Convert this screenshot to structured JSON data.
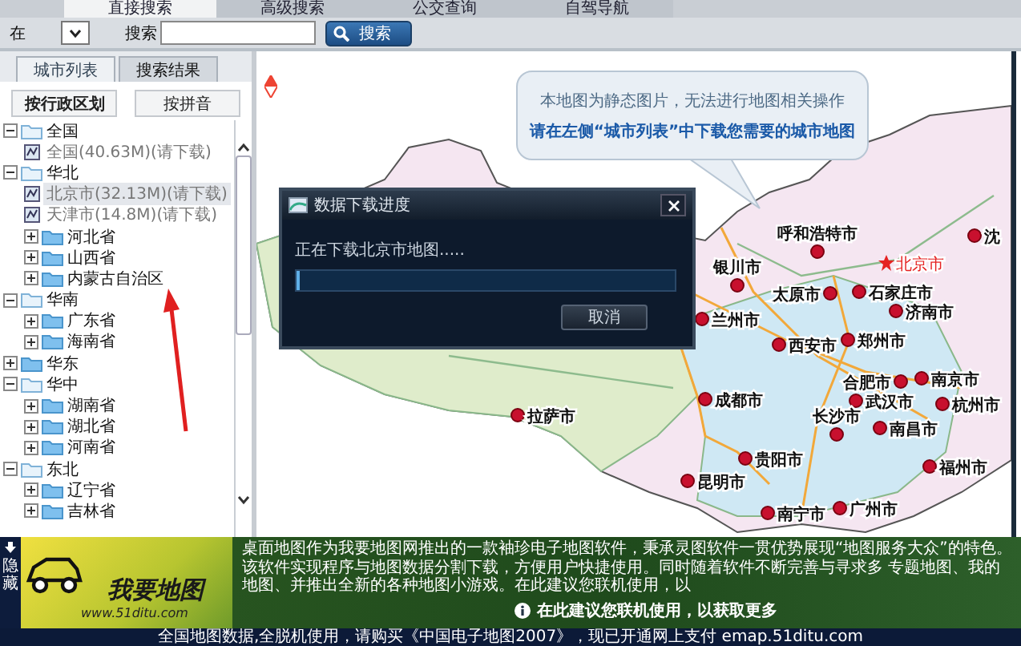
{
  "top_tabs": [
    {
      "label": "直接搜索",
      "selected": true
    },
    {
      "label": "高级搜索",
      "selected": false
    },
    {
      "label": "公交查询",
      "selected": false
    },
    {
      "label": "自驾导航",
      "selected": false
    }
  ],
  "search": {
    "scope_label": "在",
    "keyword_label": "搜索",
    "button": "搜索"
  },
  "left_panel": {
    "tabs": [
      {
        "label": "城市列表",
        "selected": true
      },
      {
        "label": "搜索结果",
        "selected": false
      }
    ],
    "sort_buttons": [
      {
        "label": "按行政区划",
        "selected": true
      },
      {
        "label": "按拼音",
        "selected": false
      }
    ],
    "tree": [
      {
        "kind": "folder",
        "label": "全国",
        "expanded": true,
        "children": [
          {
            "kind": "file",
            "label": "全国(40.63M)(请下载)",
            "selected": false
          }
        ]
      },
      {
        "kind": "folder",
        "label": "华北",
        "expanded": true,
        "children": [
          {
            "kind": "file",
            "label": "北京市(32.13M)(请下载)",
            "selected": true
          },
          {
            "kind": "file",
            "label": "天津市(14.8M)(请下载)",
            "selected": false
          },
          {
            "kind": "folder",
            "label": "河北省",
            "expanded": false
          },
          {
            "kind": "folder",
            "label": "山西省",
            "expanded": false
          },
          {
            "kind": "folder",
            "label": "内蒙古自治区",
            "expanded": false
          }
        ]
      },
      {
        "kind": "folder",
        "label": "华南",
        "expanded": true,
        "children": [
          {
            "kind": "folder",
            "label": "广东省",
            "expanded": false
          },
          {
            "kind": "folder",
            "label": "海南省",
            "expanded": false
          }
        ]
      },
      {
        "kind": "folder",
        "label": "华东",
        "expanded": false
      },
      {
        "kind": "folder",
        "label": "华中",
        "expanded": true,
        "children": [
          {
            "kind": "folder",
            "label": "湖南省",
            "expanded": false
          },
          {
            "kind": "folder",
            "label": "湖北省",
            "expanded": false
          },
          {
            "kind": "folder",
            "label": "河南省",
            "expanded": false
          }
        ]
      },
      {
        "kind": "folder",
        "label": "东北",
        "expanded": true,
        "children": [
          {
            "kind": "folder",
            "label": "辽宁省",
            "expanded": false
          },
          {
            "kind": "folder",
            "label": "吉林省",
            "expanded": false
          }
        ]
      }
    ]
  },
  "map": {
    "notice": [
      "本地图为静态图片，无法进行地图相关操作",
      "请在左侧“城市列表”中下载您需要的城市地图"
    ],
    "cities": [
      {
        "name": "呼和浩特市",
        "kind": "city"
      },
      {
        "name": "银川市",
        "kind": "city"
      },
      {
        "name": "北京市",
        "kind": "capital"
      },
      {
        "name": "太原市",
        "kind": "city"
      },
      {
        "name": "石家庄市",
        "kind": "city"
      },
      {
        "name": "济南市",
        "kind": "city"
      },
      {
        "name": "兰州市",
        "kind": "city"
      },
      {
        "name": "郑州市",
        "kind": "city"
      },
      {
        "name": "西安市",
        "kind": "city"
      },
      {
        "name": "合肥市",
        "kind": "city"
      },
      {
        "name": "南京市",
        "kind": "city"
      },
      {
        "name": "成都市",
        "kind": "city"
      },
      {
        "name": "武汉市",
        "kind": "city"
      },
      {
        "name": "杭州市",
        "kind": "city"
      },
      {
        "name": "长沙市",
        "kind": "city"
      },
      {
        "name": "南昌市",
        "kind": "city"
      },
      {
        "name": "拉萨市",
        "kind": "city"
      },
      {
        "name": "贵阳市",
        "kind": "city"
      },
      {
        "name": "福州市",
        "kind": "city"
      },
      {
        "name": "昆明市",
        "kind": "city"
      },
      {
        "name": "南宁市",
        "kind": "city"
      },
      {
        "name": "广州市",
        "kind": "city"
      },
      {
        "name": "沈",
        "kind": "city"
      }
    ]
  },
  "dialog": {
    "title": "数据下载进度",
    "message": "正在下载北京市地图.....",
    "level": 0.01,
    "button": "取消"
  },
  "banner": {
    "hide_label": "隐藏",
    "logo_title": "我要地图",
    "logo_url": "www.51ditu.com",
    "description": "桌面地图作为我要地图网推出的一款袖珍电子地图软件，秉承灵图软件一贯优势展现“地图服务大众”的特色。该软件实现程序与地图数据分割下载，方便用户快捷使用。同时随着软件不断完善与寻求多 专题地图、我的地图、并推出全新的各种地图小游戏。在此建议您联机使用，以",
    "tip": "在此建议您联机使用，以获取更多"
  },
  "status_bar": "全国地图数据,全脱机使用，请购买《中国电子地图2007》，现已开通网上支付 emap.51ditu.com"
}
